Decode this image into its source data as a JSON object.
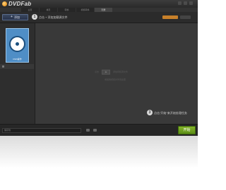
{
  "app": {
    "brand": "DVDFab",
    "accent_color": "#4f8ec6",
    "start_color": "#6da01d"
  },
  "tabs": [
    {
      "label": "主页"
    },
    {
      "label": "拷贝"
    },
    {
      "label": "转换"
    },
    {
      "label": "视频转换"
    },
    {
      "label": "刻录"
    }
  ],
  "toolbar": {
    "add_label": "添加",
    "add_icon": "plus-icon"
  },
  "hints": {
    "step1_number": "1",
    "step1_text": "点击 + 添加加载源文件",
    "step2_number": "2",
    "step2_text": "点击模式图标切换到指定工作模式",
    "step3_number": "3",
    "step3_text": "点击\"开始\"来开始处理任务"
  },
  "sidebar": {
    "mode_label": "DVD操作",
    "mode_icon": "disc-icon"
  },
  "main": {
    "center_hint_pre": "点击",
    "center_add_symbol": "+",
    "center_hint_post": "添加视频源文件",
    "center_hint_sub": "或拖拽视频文件到这里"
  },
  "bottombar": {
    "output_label": "保存到",
    "start_label": "开始"
  }
}
